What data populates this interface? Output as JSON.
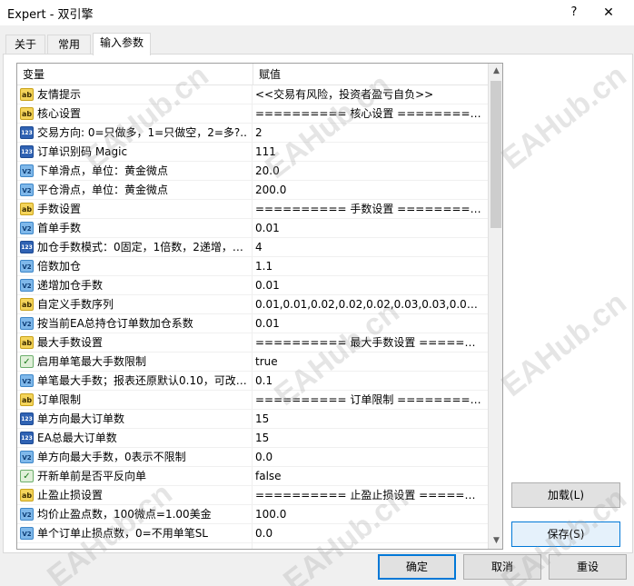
{
  "window": {
    "title": "Expert - 双引擎",
    "help_label": "?",
    "close_label": "✕"
  },
  "tabs": [
    {
      "label": "关于"
    },
    {
      "label": "常用"
    },
    {
      "label": "输入参数"
    }
  ],
  "grid": {
    "col_variable": "变量",
    "col_value": "赋值",
    "rows": [
      {
        "icon": "ab",
        "name": "友情提示",
        "value": "<<交易有风险，投资者盈亏自负>>"
      },
      {
        "icon": "ab",
        "name": "核心设置",
        "value": "========== 核心设置 =========="
      },
      {
        "icon": "123",
        "name": "交易方向: 0=只做多，1=只做空，2=多?..",
        "value": "2"
      },
      {
        "icon": "123",
        "name": "订单识别码 Magic",
        "value": "111"
      },
      {
        "icon": "v2",
        "name": "下单滑点，单位：黄金微点",
        "value": "20.0"
      },
      {
        "icon": "v2",
        "name": "平仓滑点，单位：黄金微点",
        "value": "200.0"
      },
      {
        "icon": "ab",
        "name": "手数设置",
        "value": "========== 手数设置 =========="
      },
      {
        "icon": "v2",
        "name": "首单手数",
        "value": "0.01"
      },
      {
        "icon": "123",
        "name": "加仓手数模式：0固定，1倍数，2递增，3?..",
        "value": "4"
      },
      {
        "icon": "v2",
        "name": "倍数加仓",
        "value": "1.1"
      },
      {
        "icon": "v2",
        "name": "递增加仓手数",
        "value": "0.01"
      },
      {
        "icon": "ab",
        "name": "自定义手数序列",
        "value": "0.01,0.01,0.02,0.02,0.02,0.03,0.03,0.03,0.04..."
      },
      {
        "icon": "v2",
        "name": "按当前EA总持仓订单数加仓系数",
        "value": "0.01"
      },
      {
        "icon": "ab",
        "name": "最大手数设置",
        "value": "========== 最大手数设置 =======..."
      },
      {
        "icon": "bool",
        "name": "启用单笔最大手数限制",
        "value": "true"
      },
      {
        "icon": "v2",
        "name": "单笔最大手数；报表还原默认0.10，可改0...",
        "value": "0.1"
      },
      {
        "icon": "ab",
        "name": "订单限制",
        "value": "========== 订单限制 =========="
      },
      {
        "icon": "123",
        "name": "单方向最大订单数",
        "value": "15"
      },
      {
        "icon": "123",
        "name": "EA总最大订单数",
        "value": "15"
      },
      {
        "icon": "v2",
        "name": "单方向最大手数，0表示不限制",
        "value": "0.0"
      },
      {
        "icon": "bool",
        "name": "开新单前是否平反向单",
        "value": "false"
      },
      {
        "icon": "ab",
        "name": "止盈止损设置",
        "value": "========== 止盈止损设置 =======..."
      },
      {
        "icon": "v2",
        "name": "均价止盈点数，100微点=1.00美金",
        "value": "100.0"
      },
      {
        "icon": "v2",
        "name": "单个订单止损点数，0=不用单笔SL",
        "value": "0.0"
      }
    ]
  },
  "icon_labels": {
    "ab": "ab",
    "123": "123",
    "v2": "V2",
    "bool": "✓"
  },
  "buttons": {
    "load": "加载(L)",
    "save": "保存(S)",
    "ok": "确定",
    "cancel": "取消",
    "reset": "重设"
  },
  "watermark": "EAHub.cn"
}
